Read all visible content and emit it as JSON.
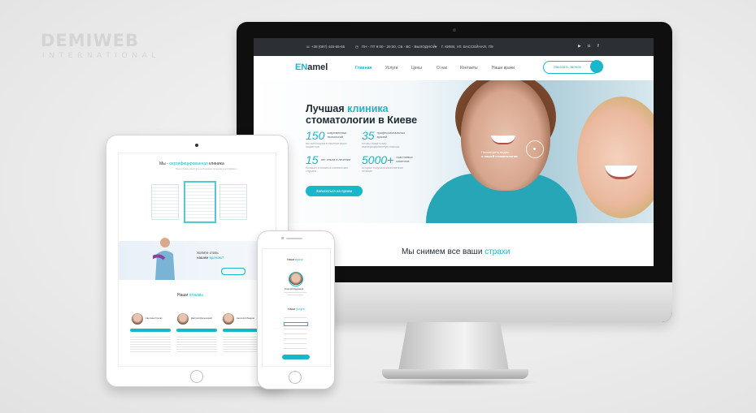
{
  "watermark": {
    "title": "DEMIWEB",
    "subtitle": "INTERNATIONAL"
  },
  "colors": {
    "accent": "#19b7c9",
    "topbar": "#2c2f33",
    "text": "#1e2a33"
  },
  "desktop": {
    "topbar": {
      "phone": "+38 (097) 445-65-65",
      "hours": "ПН - ПТ 9:00 - 20:00, СБ - ВС - ВЫХОДНОЙ",
      "address": "Г. КИЕВ, УЛ. БАССЕЙНАЯ, 7/9",
      "icons": [
        "phone-icon",
        "clock-icon",
        "pin-icon",
        "youtube-icon",
        "instagram-icon",
        "facebook-icon"
      ]
    },
    "nav": {
      "logo_accent": "EN",
      "logo_rest": "amel",
      "items": [
        "Главная",
        "Услуги",
        "Цены",
        "О нас",
        "Контакты",
        "Наши врачи"
      ],
      "active_index": 0,
      "call_button": "Заказать звонок"
    },
    "hero": {
      "title_line1_pre": "Лучшая ",
      "title_line1_accent": "клиника",
      "title_line2": "стоматологии в Киеве",
      "stats": [
        {
          "num": "150",
          "label": "современных технологий",
          "sub": "мы используем в лечении своих пациентов"
        },
        {
          "num": "35",
          "label": "профессиональных врачей",
          "sub": "готовы оказать вам квалифицированную помощь"
        },
        {
          "num": "15",
          "label": "лет опыта в лечении",
          "sub": "больших и сложных клинических случаев"
        },
        {
          "num": "5000+",
          "label": "счастливых клиентов",
          "sub": "которые получили качественное лечение"
        }
      ],
      "cta": "Записаться на прием",
      "video_text_1": "Посмотреть видео",
      "video_text_2": "о нашей стоматологии"
    },
    "section2": {
      "pre": "Мы снимем все ваши ",
      "accent": "страхи"
    }
  },
  "tablet": {
    "cert_title_pre": "Мы - ",
    "cert_title_accent": "сертифицированная",
    "cert_title_post": " клиника",
    "cert_sub": "Наша клиника имеет все необходимые лицензии и сертификаты",
    "cta_line1": "Хотите стать",
    "cta_line2_pre": "нашим ",
    "cta_line2_accent": "врачом?",
    "reviews_pre": "Наши ",
    "reviews_accent": "отзывы",
    "reviewers": [
      "Светлана Гончар",
      "Дмитрий Дольницкий",
      "Анатолий Ивашин"
    ]
  },
  "phone": {
    "title_pre": "Наши ",
    "title_accent": "врачи",
    "doctor_name": "Георгий Кирсанов",
    "services_pre": "Наши ",
    "services_accent": "услуги"
  }
}
